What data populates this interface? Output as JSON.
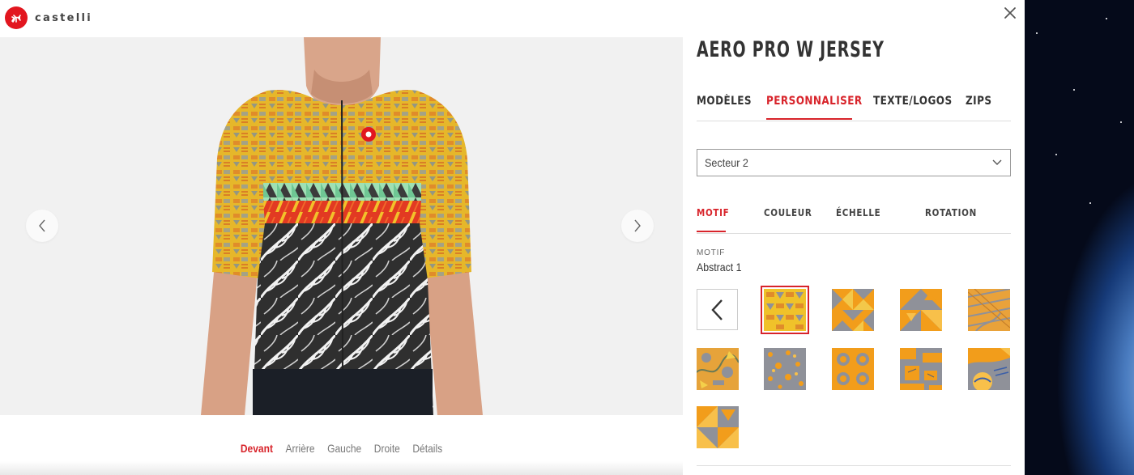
{
  "brand": {
    "name": "castelli",
    "accent": "#d8242b"
  },
  "product": {
    "title": "AERO PRO W JERSEY"
  },
  "main_tabs": [
    {
      "label": "MODÈLES",
      "active": false
    },
    {
      "label": "PERSONNALISER",
      "active": true
    },
    {
      "label": "TEXTE/LOGOS",
      "active": false
    },
    {
      "label": "ZIPS",
      "active": false
    }
  ],
  "sector_select": {
    "value": "Secteur 2"
  },
  "sub_tabs": [
    {
      "label": "MOTIF",
      "active": true
    },
    {
      "label": "COULEUR",
      "active": false
    },
    {
      "label": "ÉCHELLE",
      "active": false
    },
    {
      "label": "ROTATION",
      "active": false
    }
  ],
  "motif": {
    "label": "MOTIF",
    "current": "Abstract 1"
  },
  "swatches": [
    {
      "name": "motif-abstract-1",
      "selected": true
    },
    {
      "name": "motif-geometric-triangles",
      "selected": false
    },
    {
      "name": "motif-orange-triangles",
      "selected": false
    },
    {
      "name": "motif-orange-grey-lines",
      "selected": false
    },
    {
      "name": "motif-mixed-abstract",
      "selected": false
    },
    {
      "name": "motif-grey-dots",
      "selected": false
    },
    {
      "name": "motif-orange-circles",
      "selected": false
    },
    {
      "name": "motif-orange-blocks",
      "selected": false
    },
    {
      "name": "motif-sun-waves",
      "selected": false
    },
    {
      "name": "motif-triangle-grid",
      "selected": false
    }
  ],
  "view_tabs": [
    {
      "label": "Devant",
      "active": true
    },
    {
      "label": "Arrière",
      "active": false
    },
    {
      "label": "Gauche",
      "active": false
    },
    {
      "label": "Droite",
      "active": false
    },
    {
      "label": "Détails",
      "active": false
    }
  ],
  "colors": {
    "swatch_orange": "#f29d1b",
    "swatch_grey": "#8f9199",
    "swatch_yellow": "#f0c22a",
    "viewer_bg": "#f1f1f1"
  }
}
